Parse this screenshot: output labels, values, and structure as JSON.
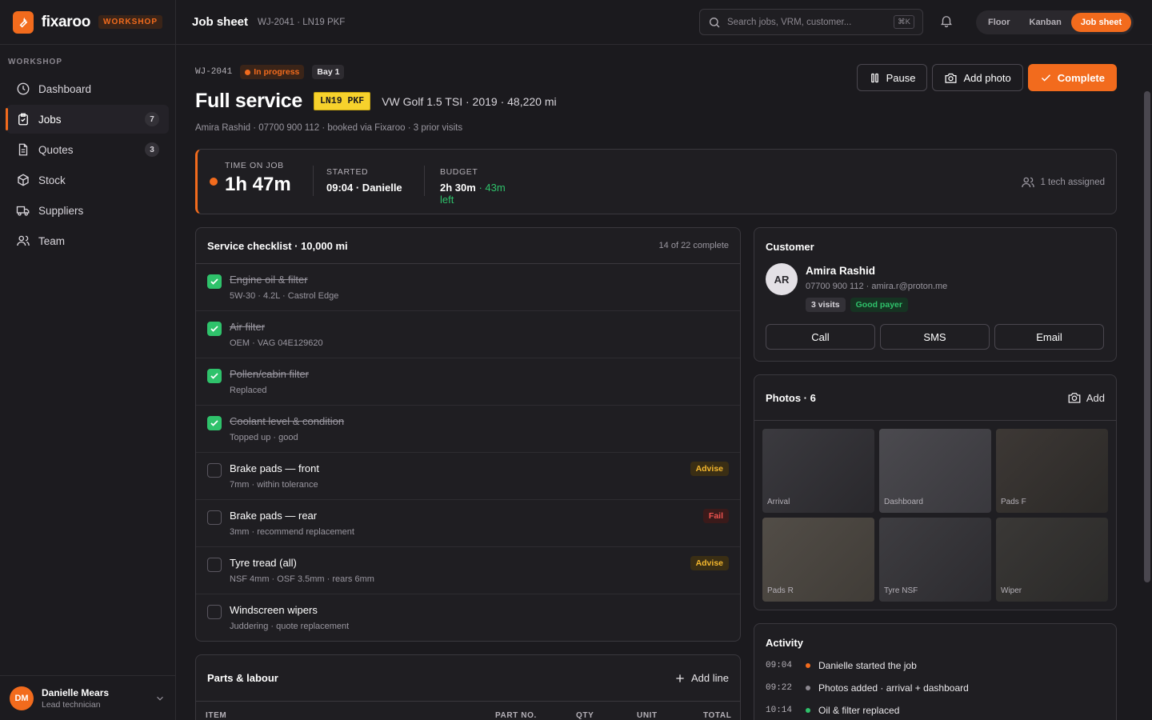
{
  "brand": {
    "name": "fixaroo",
    "tag": "WORKSHOP"
  },
  "sidebar": {
    "section": "WORKSHOP",
    "items": [
      {
        "label": "Dashboard",
        "icon": "clock-icon"
      },
      {
        "label": "Jobs",
        "icon": "clipboard-check-icon",
        "count": "7",
        "active": true
      },
      {
        "label": "Quotes",
        "icon": "document-icon",
        "count": "3"
      },
      {
        "label": "Stock",
        "icon": "box-icon"
      },
      {
        "label": "Suppliers",
        "icon": "truck-icon"
      },
      {
        "label": "Team",
        "icon": "users-icon"
      }
    ],
    "user": {
      "initials": "DM",
      "name": "Danielle Mears",
      "role": "Lead technician"
    }
  },
  "topbar": {
    "title": "Job sheet",
    "subtitle": "WJ-2041 · LN19 PKF",
    "search_placeholder": "Search jobs, VRM, customer...",
    "shortcut": "⌘K",
    "views": [
      "Floor",
      "Kanban",
      "Job sheet"
    ],
    "active_view": "Job sheet"
  },
  "job": {
    "id": "WJ-2041",
    "status": "In progress",
    "bay": "Bay 1",
    "title": "Full service",
    "plate": "LN19 PKF",
    "vehicle": "VW Golf 1.5 TSI · 2019 · 48,220 mi",
    "customer_line": "Amira Rashid · 07700 900 112 · booked via Fixaroo · 3 prior visits"
  },
  "actions": {
    "pause": "Pause",
    "add_photo": "Add photo",
    "complete": "Complete"
  },
  "timer": {
    "time_label": "TIME ON JOB",
    "time_value": "1h 47m",
    "started_label": "STARTED",
    "started_value": "09:04 · Danielle",
    "budget_label": "BUDGET",
    "budget_value": "2h 30m",
    "budget_left": "· 43m",
    "budget_left_word": "left",
    "techs": "1 tech assigned"
  },
  "checklist": {
    "title": "Service checklist · 10,000 mi",
    "progress": "14 of 22 complete",
    "items": [
      {
        "title": "Engine oil & filter",
        "sub": "5W-30 · 4.2L · Castrol Edge",
        "done": true
      },
      {
        "title": "Air filter",
        "sub": "OEM · VAG 04E129620",
        "done": true
      },
      {
        "title": "Pollen/cabin filter",
        "sub": "Replaced",
        "done": true
      },
      {
        "title": "Coolant level & condition",
        "sub": "Topped up · good",
        "done": true
      },
      {
        "title": "Brake pads — front",
        "sub": "7mm · within tolerance",
        "done": false,
        "badge": "Advise"
      },
      {
        "title": "Brake pads — rear",
        "sub": "3mm · recommend replacement",
        "done": false,
        "badge": "Fail"
      },
      {
        "title": "Tyre tread (all)",
        "sub": "NSF 4mm · OSF 3.5mm · rears 6mm",
        "done": false,
        "badge": "Advise"
      },
      {
        "title": "Windscreen wipers",
        "sub": "Juddering · quote replacement",
        "done": false
      }
    ]
  },
  "parts": {
    "title": "Parts & labour",
    "add_line": "Add line",
    "columns": [
      "ITEM",
      "PART NO.",
      "QTY",
      "UNIT",
      "TOTAL"
    ]
  },
  "customer": {
    "heading": "Customer",
    "initials": "AR",
    "name": "Amira Rashid",
    "contact": "07700 900 112 · amira.r@proton.me",
    "visits": "3 visits",
    "payer": "Good payer",
    "buttons": [
      "Call",
      "SMS",
      "Email"
    ]
  },
  "photos": {
    "title": "Photos · 6",
    "add": "Add",
    "items": [
      "Arrival",
      "Dashboard",
      "Pads F",
      "Pads R",
      "Tyre NSF",
      "Wiper"
    ]
  },
  "activity": {
    "title": "Activity",
    "items": [
      {
        "time": "09:04",
        "text": "Danielle started the job",
        "color": "#f26b1d"
      },
      {
        "time": "09:22",
        "text": "Photos added · arrival + dashboard",
        "color": "#8c8890"
      },
      {
        "time": "10:14",
        "text": "Oil & filter replaced",
        "color": "#2fc26b"
      }
    ]
  },
  "colors": {
    "accent": "#f26b1d",
    "success": "#2fc26b",
    "warning": "#f5b82e",
    "danger": "#ef5350"
  }
}
